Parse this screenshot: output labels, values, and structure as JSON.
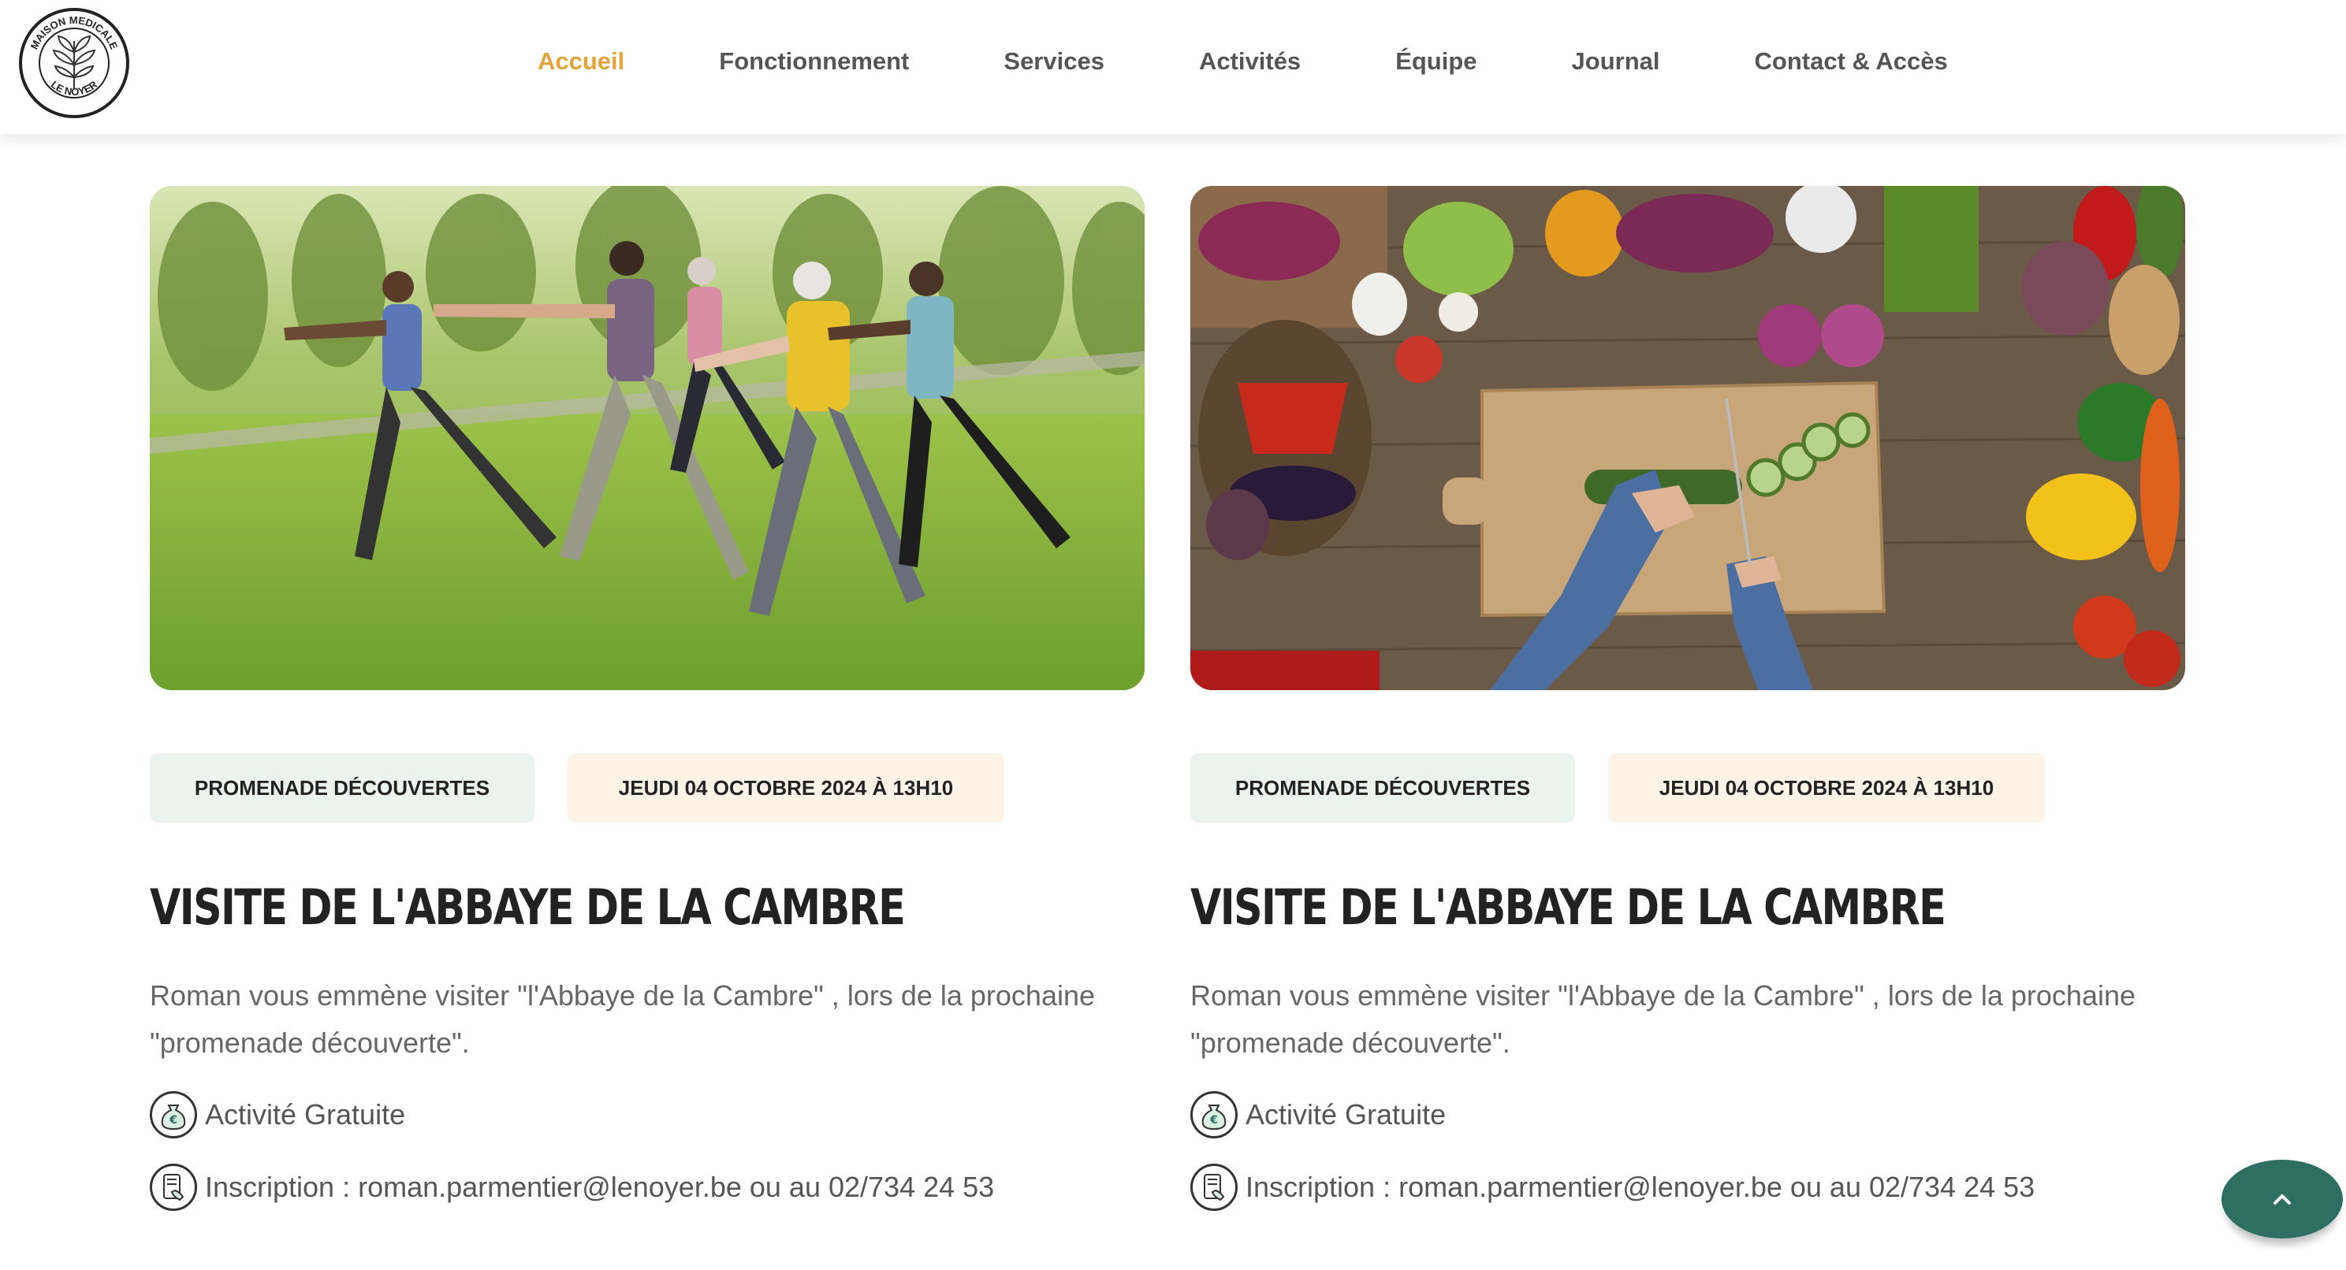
{
  "site": {
    "logo_text_top": "MAISON MEDICALE",
    "logo_text_bottom": "LE NOYER"
  },
  "nav": [
    {
      "label": "Accueil",
      "active": true
    },
    {
      "label": "Fonctionnement",
      "active": false
    },
    {
      "label": "Services",
      "active": false
    },
    {
      "label": "Activités",
      "active": false
    },
    {
      "label": "Équipe",
      "active": false
    },
    {
      "label": "Journal",
      "active": false
    },
    {
      "label": "Contact & Accès",
      "active": false
    }
  ],
  "cards": [
    {
      "image": "tai-chi-outdoor-group-photo",
      "category": "PROMENADE DÉCOUVERTES",
      "date": "JEUDI 04 OCTOBRE 2024 À 13H10",
      "title": "VISITE DE L'ABBAYE DE LA CAMBRE",
      "description": "Roman vous emmène visiter \"l'Abbaye de la Cambre\" , lors de la prochaine \"promenade découverte\".",
      "price_icon": "money-bag-icon",
      "price": "Activité Gratuite",
      "contact_icon": "phone-note-icon",
      "contact": "Inscription : roman.parmentier@lenoyer.be ou au 02/734 24 53"
    },
    {
      "image": "vegetables-cutting-board-photo",
      "category": "PROMENADE DÉCOUVERTES",
      "date": "JEUDI 04 OCTOBRE 2024 À 13H10",
      "title": "VISITE DE L'ABBAYE DE LA CAMBRE",
      "description": "Roman vous emmène visiter \"l'Abbaye de la Cambre\" , lors de la prochaine \"promenade découverte\".",
      "price_icon": "money-bag-icon",
      "price": "Activité Gratuite",
      "contact_icon": "phone-note-icon",
      "contact": "Inscription : roman.parmentier@lenoyer.be ou au 02/734 24 53"
    }
  ],
  "colors": {
    "accent": "#e3a43a",
    "nav_text": "#555555",
    "tag_category_bg": "#eaf3ee",
    "tag_date_bg": "#fdf3e7",
    "scroll_button": "#2f6f62"
  },
  "scroll_top_icon": "chevron-up-icon"
}
